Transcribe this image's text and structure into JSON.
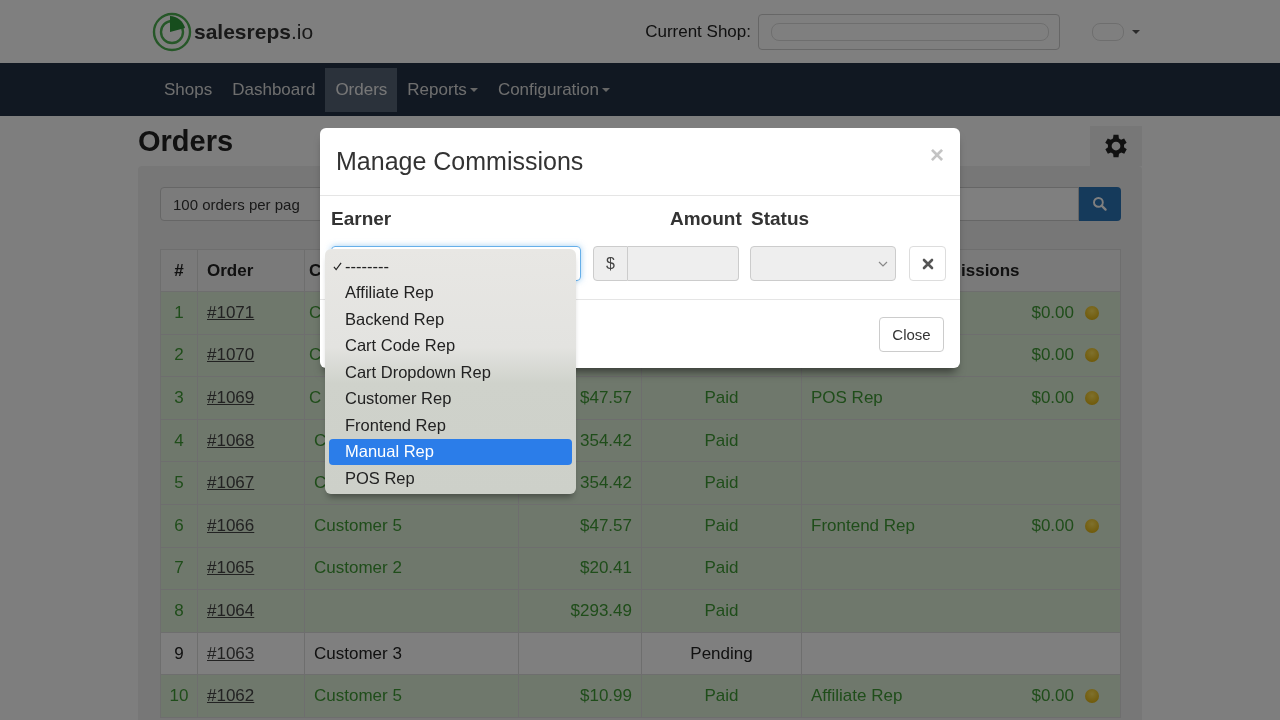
{
  "header": {
    "logo": "**salesreps**.io",
    "shop_label": "Current Shop:",
    "shop_redacted": true,
    "user_redacted": true
  },
  "nav": [
    {
      "label": "Shops",
      "selected": false,
      "dropdown": false
    },
    {
      "label": "Dashboard",
      "selected": false,
      "dropdown": false
    },
    {
      "label": "Orders",
      "selected": true,
      "dropdown": false
    },
    {
      "label": "Reports",
      "selected": false,
      "dropdown": true
    },
    {
      "label": "Configuration",
      "selected": false,
      "dropdown": true
    }
  ],
  "page": {
    "title": "Orders",
    "per_page": "100 orders per pag"
  },
  "table": {
    "columns": {
      "number": "#",
      "order": "Order",
      "customer": "C",
      "commissions": "issions"
    },
    "rows": [
      {
        "number": "1",
        "order": "#1071",
        "customer": "C",
        "commission": "$0.00",
        "paid": true,
        "status_dot": true
      },
      {
        "number": "2",
        "order": "#1070",
        "customer": "C",
        "commission": "$0.00",
        "paid": true,
        "status_dot": true
      },
      {
        "number": "3",
        "order": "#1069",
        "customer": "C",
        "total": "$47.57",
        "status": "Paid",
        "rep": "POS Rep",
        "commission": "$0.00",
        "paid": true,
        "status_dot": true
      },
      {
        "number": "4",
        "order": "#1068",
        "customer": "C",
        "total": "354.42",
        "status": "Paid",
        "paid": true,
        "status_dot": false
      },
      {
        "number": "5",
        "order": "#1067",
        "customer": "C",
        "total": "354.42",
        "status": "Paid",
        "paid": true,
        "status_dot": false
      },
      {
        "number": "6",
        "order": "#1066",
        "customer": "Customer 5",
        "total": "$47.57",
        "status": "Paid",
        "rep": "Frontend Rep",
        "commission": "$0.00",
        "paid": true,
        "status_dot": true
      },
      {
        "number": "7",
        "order": "#1065",
        "customer": "Customer 2",
        "total": "$20.41",
        "status": "Paid",
        "paid": true,
        "status_dot": false
      },
      {
        "number": "8",
        "order": "#1064",
        "total": "$293.49",
        "status": "Paid",
        "paid": true,
        "status_dot": false
      },
      {
        "number": "9",
        "order": "#1063",
        "customer": "Customer 3",
        "status": "Pending",
        "paid": false,
        "status_dot": false
      },
      {
        "number": "10",
        "order": "#1062",
        "customer": "Customer 5",
        "total": "$10.99",
        "status": "Paid",
        "rep": "Affiliate Rep",
        "commission": "$0.00",
        "paid": true,
        "status_dot": true
      }
    ]
  },
  "modal": {
    "title": "Manage Commissions",
    "close": "×",
    "labels": {
      "earner": "Earner",
      "amount": "Amount",
      "status": "Status"
    },
    "currency": "$",
    "close_button": "Close",
    "earner_options": [
      {
        "label": "--------",
        "checked": true,
        "selected": false
      },
      {
        "label": "Affiliate Rep",
        "checked": false,
        "selected": false
      },
      {
        "label": "Backend Rep",
        "checked": false,
        "selected": false
      },
      {
        "label": "Cart Code Rep",
        "checked": false,
        "selected": false
      },
      {
        "label": "Cart Dropdown Rep",
        "checked": false,
        "selected": false
      },
      {
        "label": "Customer Rep",
        "checked": false,
        "selected": false
      },
      {
        "label": "Frontend Rep",
        "checked": false,
        "selected": false
      },
      {
        "label": "Manual Rep",
        "checked": false,
        "selected": true
      },
      {
        "label": "POS Rep",
        "checked": false,
        "selected": false
      }
    ]
  }
}
